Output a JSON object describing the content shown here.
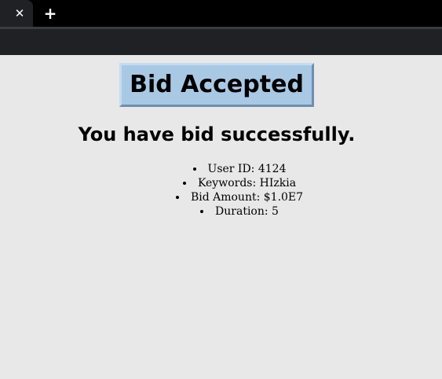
{
  "browser": {
    "close_tab_glyph": "✕",
    "new_tab_glyph": "+"
  },
  "page": {
    "badge_text": "Bid Accepted",
    "heading": "You have bid successfully.",
    "details": [
      {
        "label": "User ID: 4124"
      },
      {
        "label": "Keywords: HIzkia"
      },
      {
        "label": "Bid Amount: $1.0E7"
      },
      {
        "label": "Duration: 5"
      }
    ]
  }
}
